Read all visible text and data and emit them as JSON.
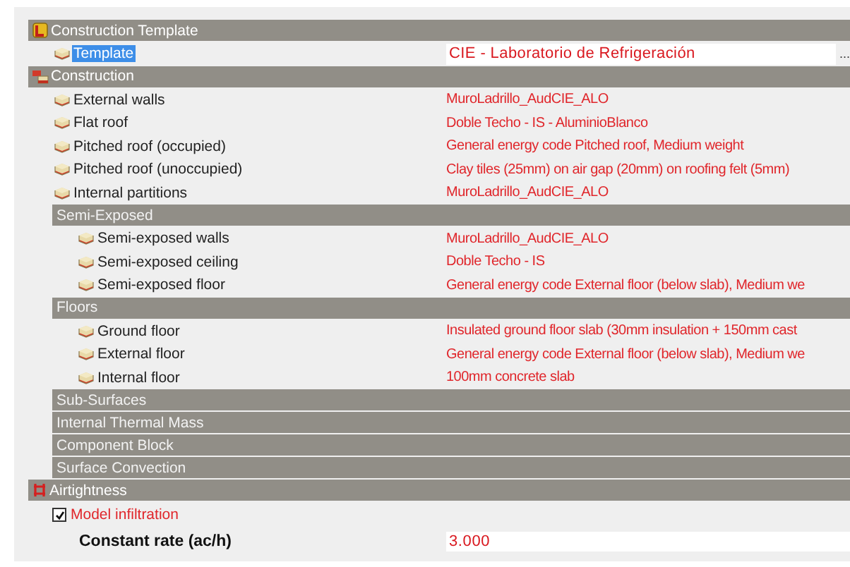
{
  "sections": [
    {
      "title": "Construction Template",
      "rows": [
        {
          "kind": "template",
          "label": "Template",
          "value": "CIE - Laboratorio de Refrigeración",
          "button": "...",
          "selected": true
        }
      ]
    },
    {
      "title": "Construction",
      "rows": [
        {
          "kind": "row",
          "label": "External walls",
          "value": "MuroLadrillo_AudCIE_ALO",
          "selected": false
        },
        {
          "kind": "row",
          "label": "Flat roof",
          "value": "Doble Techo - IS - AluminioBlanco",
          "selected": false
        },
        {
          "kind": "row",
          "label": "Pitched roof (occupied)",
          "value": "General energy code Pitched roof, Medium weight",
          "selected": false
        },
        {
          "kind": "row",
          "label": "Pitched roof (unoccupied)",
          "value": "Clay tiles (25mm) on air gap (20mm) on roofing felt (5mm)",
          "selected": false
        },
        {
          "kind": "row",
          "label": "Internal partitions",
          "value": "MuroLadrillo_AudCIE_ALO",
          "selected": false
        },
        {
          "kind": "group",
          "title": "Semi-Exposed",
          "children": [
            {
              "kind": "row",
              "label": "Semi-exposed walls",
              "value": "MuroLadrillo_AudCIE_ALO",
              "selected": false
            },
            {
              "kind": "row",
              "label": "Semi-exposed ceiling",
              "value": "Doble Techo - IS",
              "selected": false
            },
            {
              "kind": "row",
              "label": "Semi-exposed floor",
              "value": "General energy code External floor (below slab), Medium we",
              "selected": false
            }
          ]
        },
        {
          "kind": "group",
          "title": "Floors",
          "children": [
            {
              "kind": "row",
              "label": "Ground floor",
              "value": "Insulated ground floor slab (30mm insulation + 150mm cast",
              "selected": false
            },
            {
              "kind": "row",
              "label": "External floor",
              "value": "General energy code External floor (below slab), Medium we",
              "selected": false
            },
            {
              "kind": "row",
              "label": "Internal floor",
              "value": "100mm concrete slab",
              "selected": false
            }
          ]
        },
        {
          "kind": "group",
          "title": "Sub-Surfaces"
        },
        {
          "kind": "group",
          "title": "Internal Thermal Mass"
        },
        {
          "kind": "group",
          "title": "Component Block"
        },
        {
          "kind": "group",
          "title": "Surface Convection"
        }
      ]
    },
    {
      "title": "Airtightness",
      "rows": [
        {
          "kind": "checkbox",
          "label": "Model infiltration",
          "checked": true
        },
        {
          "kind": "field",
          "label": "Constant rate (ac/h)",
          "value": "3.000"
        }
      ]
    }
  ]
}
